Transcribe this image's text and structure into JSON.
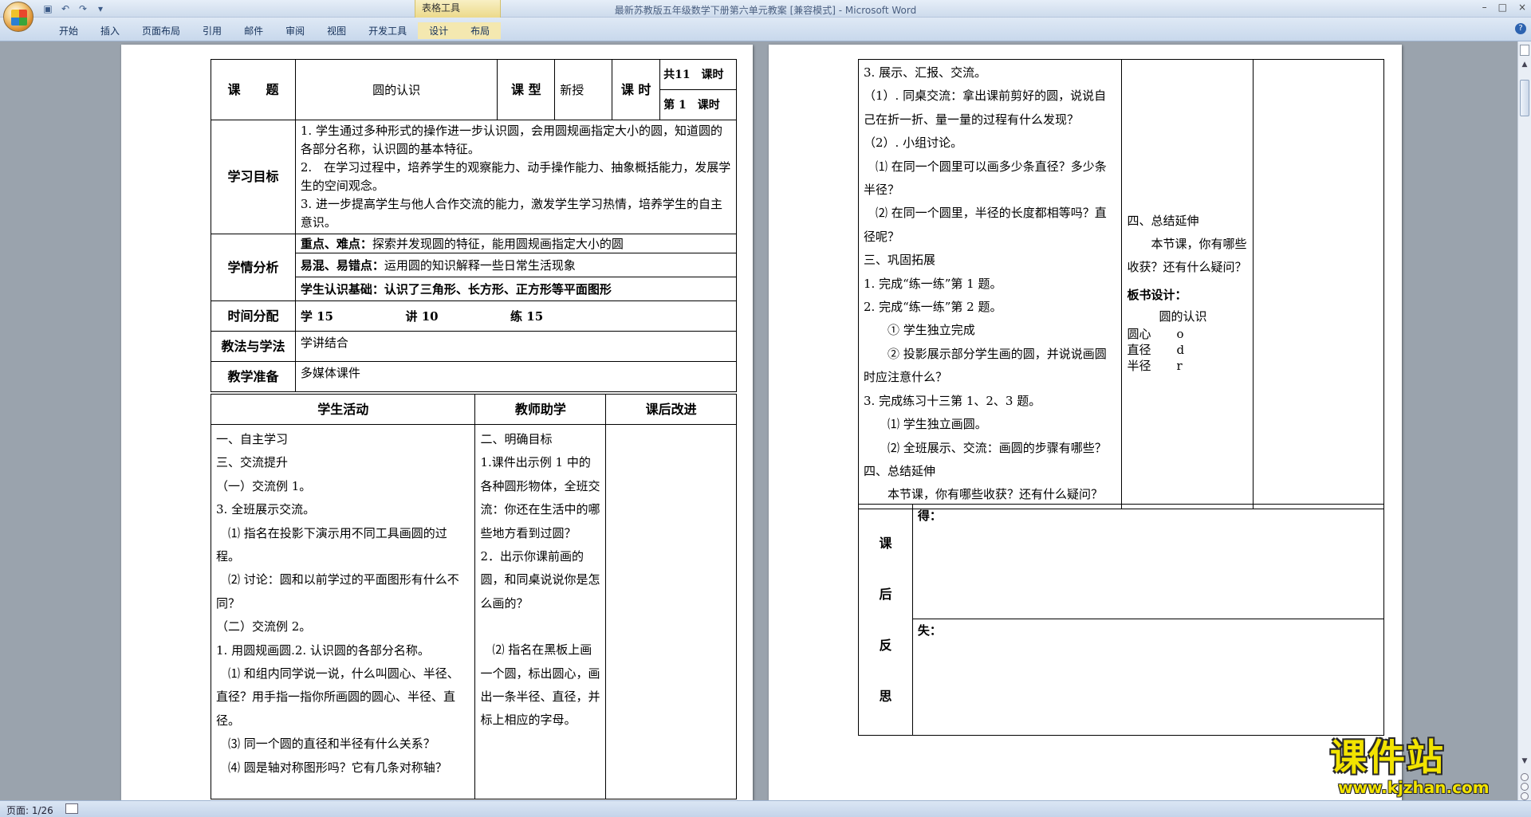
{
  "window": {
    "title": "最新苏教版五年级数学下册第六单元教案 [兼容模式] - Microsoft Word",
    "context_tab_group": "表格工具",
    "controls": [
      "–",
      "□",
      "×"
    ]
  },
  "ribbon": {
    "tabs": [
      "开始",
      "插入",
      "页面布局",
      "引用",
      "邮件",
      "审阅",
      "视图",
      "开发工具",
      "设计",
      "布局"
    ],
    "help": "?"
  },
  "page1": {
    "header_row": {
      "topic_label": "课　　题",
      "topic": "圆的认识",
      "type_label": "课 型",
      "type": "新授",
      "hours_label": "课 时",
      "total": "共11　课时",
      "current": "第 1　课时"
    },
    "goals_label": "学习目标",
    "goals": [
      "1. 学生通过多种形式的操作进一步认识圆，会用圆规画指定大小的圆，知道圆的各部分名称，认识圆的基本特征。",
      "2.　在学习过程中，培养学生的观察能力、动手操作能力、抽象概括能力，发展学生的空间观念。",
      "3. 进一步提高学生与他人合作交流的能力，激发学生学习热情，培养学生的自主意识。"
    ],
    "analysis_label": "学情分析",
    "analysis": [
      {
        "head": "重点、难点：",
        "text": "探索并发现圆的特征，能用圆规画指定大小的圆"
      },
      {
        "head": "易混、易错点：",
        "text": "运用圆的知识解释一些日常生活现象"
      },
      {
        "head": "学生认识基础：",
        "text": "认识了三角形、长方形、正方形等平面图形"
      }
    ],
    "time_label": "时间分配",
    "time": {
      "learn": "学 15",
      "teach": "讲 10",
      "practice": "练 15"
    },
    "method_label": "教法与学法",
    "method": "学讲结合",
    "prep_label": "教学准备",
    "prep": "多媒体课件",
    "columns": [
      "学生活动",
      "教师助学",
      "课后改进"
    ],
    "student_activity": [
      "一、自主学习",
      "三、交流提升",
      "（一）交流例 1。",
      "3. 全班展示交流。",
      "⑴ 指名在投影下演示用不同工具画圆的过程。",
      "⑵ 讨论：圆和以前学过的平面图形有什么不同？",
      "（二）交流例 2。",
      "1. 用圆规画圆.2. 认识圆的各部分名称。",
      "⑴ 和组内同学说一说，什么叫圆心、半径、直径？用手指一指你所画圆的圆心、半径、直径。",
      "⑶ 同一个圆的直径和半径有什么关系？",
      "⑷ 圆是轴对称图形吗？它有几条对称轴？"
    ],
    "teacher_help": [
      "二、明确目标",
      "1.课件出示例 1 中的各种圆形物体，全班交流：你还在生活中的哪些地方看到过圆？",
      "2．出示你课前画的圆，和同桌说说你是怎么画的？",
      "",
      "⑵ 指名在黑板上画一个圆，标出圆心，画出一条半径、直径，并标上相应的字母。"
    ]
  },
  "page2": {
    "student_activity": [
      "3. 展示、汇报、交流。",
      "（1）. 同桌交流：拿出课前剪好的圆，说说自己在折一折、量一量的过程有什么发现？",
      "（2）. 小组讨论。",
      "⑴ 在同一个圆里可以画多少条直径？多少条半径？",
      "⑵ 在同一个圆里，半径的长度都相等吗？直径呢？",
      "三、巩固拓展",
      "1. 完成“练一练”第 1 题。",
      "2. 完成“练一练”第 2 题。",
      "① 学生独立完成",
      "② 投影展示部分学生画的圆，并说说画圆时应注意什么？",
      "3. 完成练习十三第 1、2、3 题。",
      "⑴ 学生独立画圆。",
      "⑵ 全班展示、交流：画圆的步骤有哪些？",
      "四、总结延伸",
      "本节课，你有哪些收获？还有什么疑问？"
    ],
    "teacher_help": {
      "summary_title": "四、总结延伸",
      "summary_text": "本节课，你有哪些收获？还有什么疑问？",
      "board_title": "板书设计：",
      "board_center": "圆的认识",
      "board_rows": [
        {
          "term": "圆心",
          "sym": "o"
        },
        {
          "term": "直径",
          "sym": "d"
        },
        {
          "term": "半径",
          "sym": "r"
        }
      ]
    },
    "reflection_label": [
      "课",
      "后",
      "反",
      "思"
    ],
    "gain_label": "得：",
    "loss_label": "失："
  },
  "status": {
    "page": "页面: 1/26"
  },
  "watermark": {
    "text": "课件站",
    "url": "www.kjzhan.com"
  }
}
